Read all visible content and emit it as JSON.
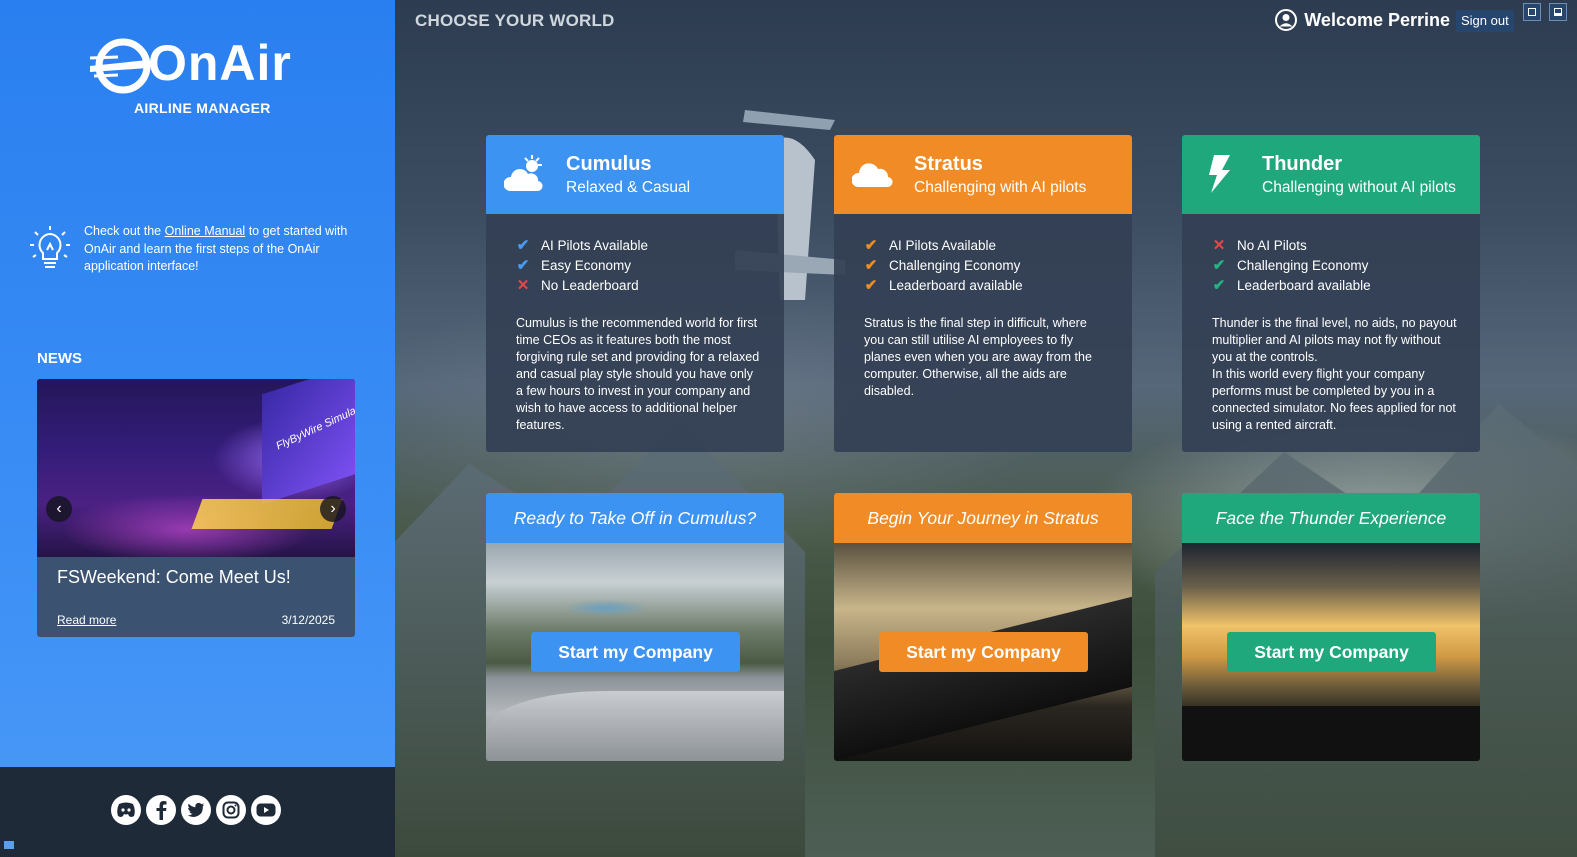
{
  "brand": {
    "logo_text": "OnAir",
    "logo_subtitle": "AIRLINE MANAGER"
  },
  "tip": {
    "prefix": "Check out the ",
    "link": "Online Manual",
    "suffix": " to get started with OnAir and learn the first steps of the OnAir application interface!"
  },
  "news": {
    "section_title": "NEWS",
    "headline": "FSWeekend: Come Meet Us!",
    "read_more": "Read more",
    "date": "3/12/2025",
    "image_caption": "FlyByWire Simulation"
  },
  "socials": [
    "discord-icon",
    "facebook-icon",
    "twitter-icon",
    "instagram-icon",
    "youtube-icon"
  ],
  "header": {
    "title": "CHOOSE YOUR WORLD",
    "welcome": "Welcome Perrine",
    "sign_out": "Sign out"
  },
  "worlds": [
    {
      "name": "Cumulus",
      "subtitle": "Relaxed & Casual",
      "color": "#3d93f1",
      "icon": "sun-cloud-icon",
      "features": [
        {
          "label": "AI Pilots Available",
          "ok": true
        },
        {
          "label": "Easy Economy",
          "ok": true
        },
        {
          "label": "No Leaderboard",
          "ok": false
        }
      ],
      "description": "Cumulus is the recommended world for first time CEOs as it features both the most forgiving rule set and providing for a relaxed and casual play style should you have only a few hours to invest in your company and wish to have access to additional helper features.",
      "cta_title": "Ready to Take Off in Cumulus?",
      "cta_button": "Start my Company"
    },
    {
      "name": "Stratus",
      "subtitle": "Challenging with AI pilots",
      "color": "#f08b26",
      "icon": "cloud-icon",
      "features": [
        {
          "label": "AI Pilots Available",
          "ok": true
        },
        {
          "label": "Challenging Economy",
          "ok": true
        },
        {
          "label": "Leaderboard available",
          "ok": true
        }
      ],
      "description": "Stratus is the final step in difficult, where you can still utilise AI employees to fly planes even when you are away from the computer. Otherwise, all the aids are disabled.",
      "cta_title": "Begin Your Journey in Stratus",
      "cta_button": "Start my Company"
    },
    {
      "name": "Thunder",
      "subtitle": "Challenging without AI pilots",
      "color": "#1ea87c",
      "icon": "lightning-icon",
      "features": [
        {
          "label": "No AI Pilots",
          "ok": false
        },
        {
          "label": "Challenging Economy",
          "ok": true
        },
        {
          "label": "Leaderboard available",
          "ok": true
        }
      ],
      "description": "Thunder is the final level, no aids, no payout multiplier and AI pilots may not fly without you at the controls.\nIn this world every flight your company performs must be completed by you in a connected simulator. No fees applied for not using a rented aircraft.",
      "cta_title": "Face the Thunder Experience",
      "cta_button": "Start my Company"
    }
  ],
  "colors": {
    "sidebar": "#2a7ff0",
    "cumulus": "#3d93f1",
    "stratus": "#f08b26",
    "thunder": "#1ea87c",
    "negative": "#e54848"
  }
}
